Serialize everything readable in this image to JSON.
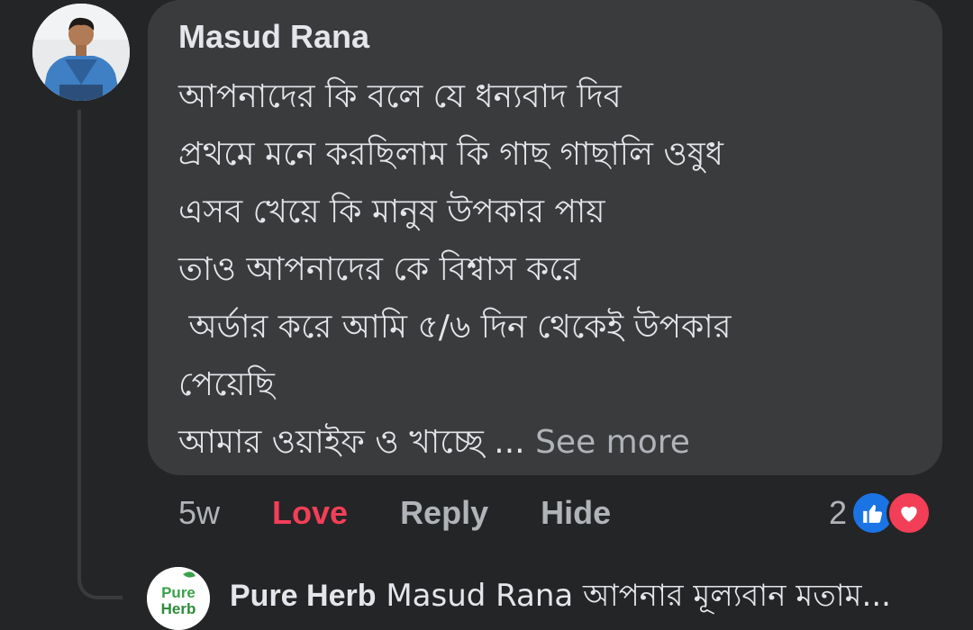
{
  "comment": {
    "author": "Masud Rana",
    "lines": [
      "আপনাদের কি বলে যে ধন্যবাদ দিব",
      "প্রথমে মনে করছিলাম কি গাছ গাছালি ওষুধ",
      "এসব খেয়ে কি মানুষ উপকার পায়",
      "তাও আপনাদের কে বিশ্বাস করে",
      " অর্ডার করে আমি ৫/৬ দিন থেকেই উপকার",
      "পেয়েছি",
      "আমার ওয়াইফ ও খাচ্ছে ... "
    ],
    "see_more": "See more"
  },
  "actions": {
    "time": "5w",
    "love": "Love",
    "reply": "Reply",
    "hide": "Hide"
  },
  "reactions": {
    "count": "2",
    "icons": [
      "like-icon",
      "heart-icon"
    ],
    "colors": {
      "like": "#1b74e4",
      "love": "#f33e58"
    }
  },
  "reply": {
    "avatar_text_1": "Pure",
    "avatar_text_2": "Herb",
    "author": "Pure Herb",
    "text": "Masud Rana আপনার মূল্যবান মতাম..."
  },
  "colors": {
    "background": "#242526",
    "bubble": "#3a3b3c",
    "text": "#e4e6eb",
    "muted": "#b0b3b8"
  }
}
